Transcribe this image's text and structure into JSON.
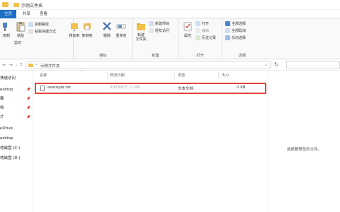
{
  "window": {
    "title": "示例文件夹"
  },
  "tabs": [
    {
      "label": "主页",
      "active": true
    },
    {
      "label": "共享",
      "active": false
    },
    {
      "label": "查看",
      "active": false
    }
  ],
  "ribbon": {
    "clipboard": {
      "label": "剪贴板",
      "pin_label": "固定到快速访问",
      "copy_label": "复制",
      "paste_label": "粘贴",
      "cut_label": "剪切",
      "copy_path_label": "复制路径",
      "paste_shortcut_label": "粘贴快捷方式"
    },
    "organize": {
      "label": "组织",
      "move_label": "移动到",
      "copyto_label": "复制到",
      "delete_label": "删除",
      "rename_label": "重命名"
    },
    "new": {
      "label": "新建",
      "folder_label": "新建\n文件夹",
      "item_label": "新建项目",
      "easy_access_label": "轻松访问"
    },
    "open": {
      "label": "打开",
      "properties_label": "属性",
      "open_label": "打开",
      "edit_label": "编辑",
      "history_label": "历史记录"
    },
    "select": {
      "label": "选择",
      "all_label": "全部选择",
      "none_label": "全部取消",
      "invert_label": "反向选择"
    }
  },
  "address": {
    "path": "示例文件夹"
  },
  "nav": {
    "items": [
      {
        "label": "快速访问",
        "pinned": false
      },
      {
        "label": "esktop",
        "pinned": true
      },
      {
        "label": "载",
        "pinned": true
      },
      {
        "label": "档",
        "pinned": true
      },
      {
        "label": "片",
        "pinned": true
      },
      {
        "label": "eDrive",
        "pinned": false
      },
      {
        "label": "esktop",
        "pinned": false
      },
      {
        "label": "地磁盘 (C:)",
        "pinned": false
      },
      {
        "label": "地磁盘 (D:)",
        "pinned": false
      },
      {
        "label": "",
        "pinned": false
      }
    ],
    "pin_glyph": "📌"
  },
  "columns": {
    "name": "名称",
    "date": "修改日期",
    "type": "类型",
    "size": "大小"
  },
  "files": [
    {
      "name": "example.txt",
      "date": "2023/6/7 11:08",
      "type": "文本文档",
      "size": "0 KB"
    }
  ],
  "preview": {
    "message": "选择要预览的文件。"
  },
  "colors": {
    "accent": "#1a6fc4",
    "highlight": "#e0453a",
    "folder": "#f3c04c"
  }
}
